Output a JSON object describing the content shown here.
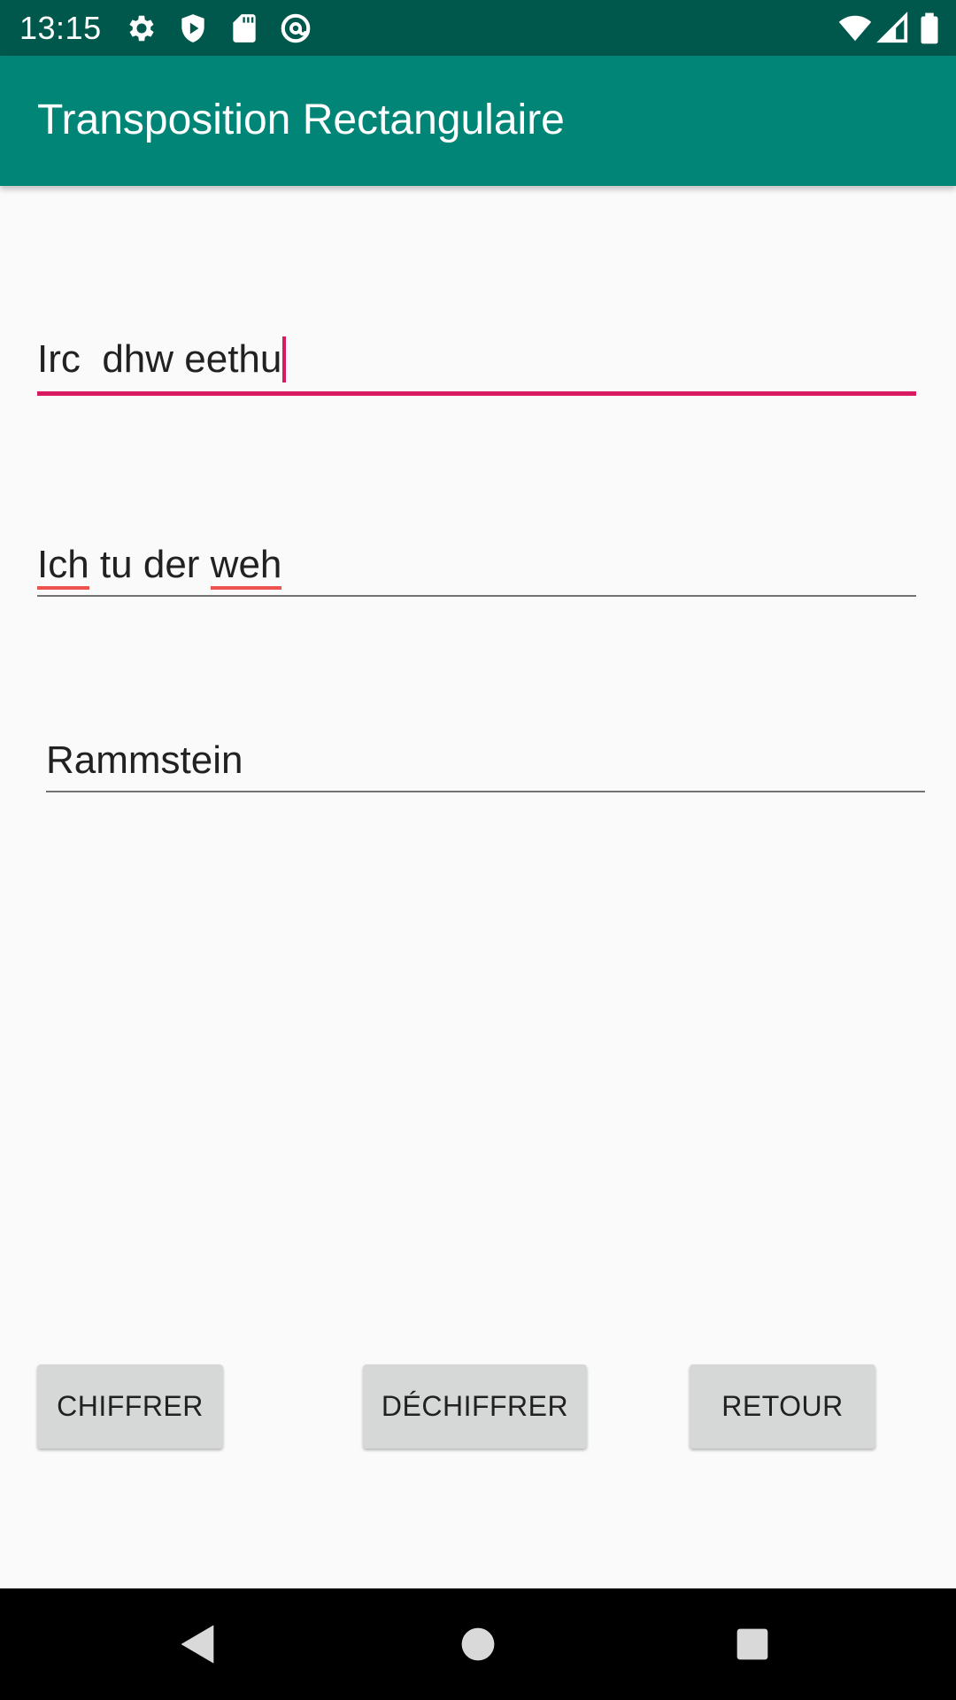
{
  "status_bar": {
    "time": "13:15",
    "left_icons": [
      "settings-icon",
      "shield-icon",
      "sd-card-icon",
      "at-sign-icon"
    ],
    "right_icons": [
      "wifi-icon",
      "signal-icon",
      "battery-icon"
    ]
  },
  "app_bar": {
    "title": "Transposition Rectangulaire",
    "color": "#008577"
  },
  "fields": {
    "cipher_text": {
      "value": "Irc  dhw eethu",
      "focused": true
    },
    "plain_text": {
      "value_parts": [
        "Ich",
        " tu der ",
        "weh"
      ]
    },
    "key": {
      "value": "Rammstein"
    }
  },
  "buttons": {
    "encrypt": "CHIFFRER",
    "decrypt": "DÉCHIFFRER",
    "back": "RETOUR"
  },
  "nav_bar": {
    "icons": [
      "back-icon",
      "home-icon",
      "recents-icon"
    ]
  },
  "colors": {
    "status_bar": "#00574b",
    "accent": "#d81b60",
    "spell_error": "#ef5350",
    "button_bg": "#d6d7d7"
  }
}
